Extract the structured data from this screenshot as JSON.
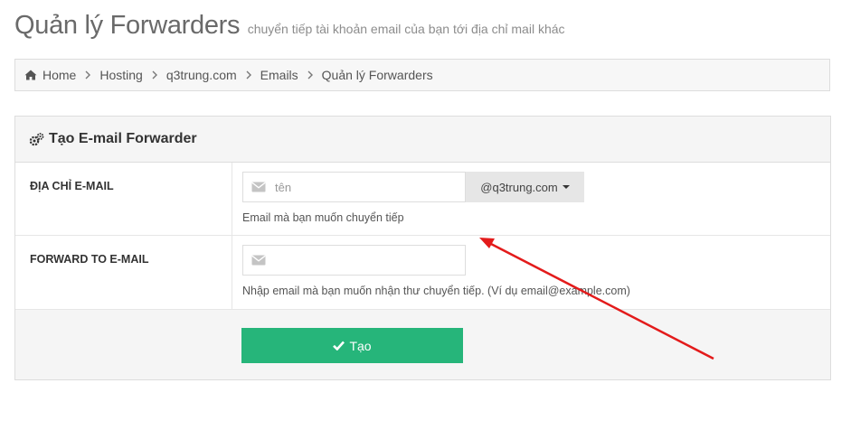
{
  "header": {
    "title": "Quản lý Forwarders",
    "subtitle": "chuyển tiếp tài khoản email của bạn tới địa chỉ mail khác"
  },
  "breadcrumb": {
    "items": [
      {
        "label": "Home",
        "icon": "home-icon"
      },
      {
        "label": "Hosting"
      },
      {
        "label": "q3trung.com"
      },
      {
        "label": "Emails"
      },
      {
        "label": "Quản lý Forwarders"
      }
    ],
    "separator_icon": "chevron-right-icon"
  },
  "panel": {
    "title": "Tạo E-mail Forwarder",
    "title_icon": "gears-icon"
  },
  "form": {
    "email_address": {
      "label": "ĐỊA CHỈ E-MAIL",
      "placeholder": "tên",
      "value": "",
      "domain": "@q3trung.com",
      "help": "Email mà bạn muốn chuyển tiếp"
    },
    "forward_to": {
      "label": "FORWARD TO E-MAIL",
      "placeholder": "",
      "value": "",
      "help": "Nhập email mà bạn muốn nhận thư chuyển tiếp. (Ví dụ email@example.com)"
    },
    "submit_label": "Tạo"
  },
  "colors": {
    "submit": "#26b57a",
    "annotation_arrow": "#e31b1b"
  }
}
